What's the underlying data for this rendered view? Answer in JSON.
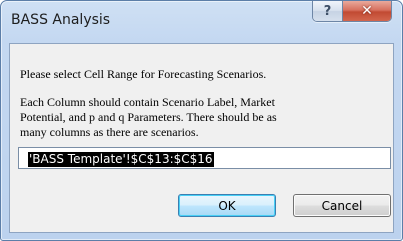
{
  "window": {
    "title": "BASS Analysis",
    "help_glyph": "?",
    "close_glyph": "✕"
  },
  "dialog": {
    "prompt_line1": "Please select Cell Range for Forecasting Scenarios.",
    "prompt_line2": "Each Column should contain Scenario Label, Market",
    "prompt_line3": "Potential, and p and q Parameters. There should be as",
    "prompt_line4": "many columns as there are scenarios.",
    "range_value": "'BASS Template'!$C$13:$C$16",
    "ok_label": "OK",
    "cancel_label": "Cancel"
  },
  "icons": {
    "help": "help-icon",
    "close": "close-icon"
  },
  "colors": {
    "title_bar": "#c4d8f1",
    "close_button": "#c14a33",
    "client_background": "#f0f0f0",
    "default_button_border": "#3c7fb1",
    "selection_background": "#000000"
  }
}
